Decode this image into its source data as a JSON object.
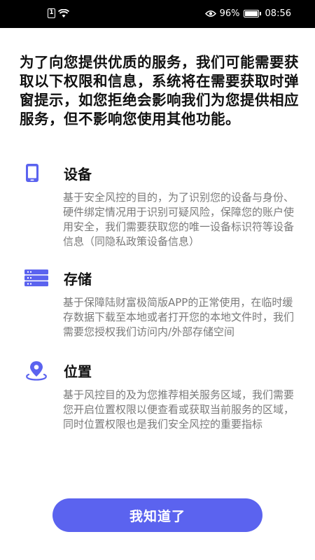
{
  "status_bar": {
    "battery": "96%",
    "time": "08:56",
    "icons": [
      "sim-card-icon",
      "wifi-icon",
      "eye-icon",
      "battery-icon"
    ]
  },
  "intro_text": "为了向您提供优质的服务，我们可能需要获取以下权限和信息，系统将在需要获取时弹窗提示，如您拒绝会影响我们为您提供相应服务，但不影响您使用其他功能。",
  "permissions": [
    {
      "icon": "phone-icon",
      "title": "设备",
      "description": "基于安全风控的目的，为了识别您的设备与身份、硬件绑定情况用于识别可疑风险，保障您的账户使用安全，我们需要获取您的唯一设备标识符等设备信息（同隐私政策设备信息）"
    },
    {
      "icon": "storage-icon",
      "title": "存储",
      "description": "基于保障陆财富极简版APP的正常使用，在临时缓存数据下载至本地或者打开您的本地文件时，我们需要您授权我们访问内/外部存储空间"
    },
    {
      "icon": "location-icon",
      "title": "位置",
      "description": "基于风控目的及为您推荐相关服务区域，我们需要您开启位置权限以便查看或获取当前服务的区域，同时位置权限也是我们安全风控的重要指标"
    }
  ],
  "button": {
    "label": "我知道了"
  },
  "colors": {
    "accent": "#5b63ef",
    "title": "#111111",
    "description": "#7a7a7a"
  }
}
